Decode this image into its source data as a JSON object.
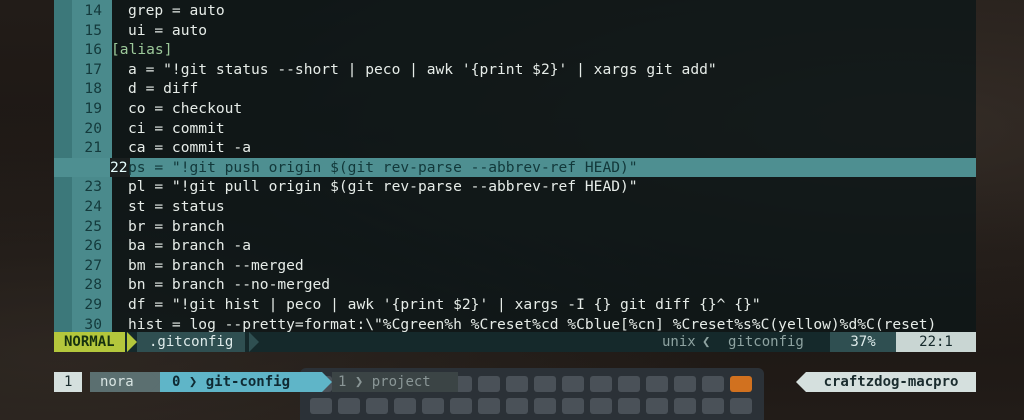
{
  "editor": {
    "lines": [
      {
        "num": "14",
        "text": "  grep = auto"
      },
      {
        "num": "15",
        "text": "  ui = auto"
      },
      {
        "num": "16",
        "text": "[alias]"
      },
      {
        "num": "17",
        "text": "  a = \"!git status --short | peco | awk '{print $2}' | xargs git add\""
      },
      {
        "num": "18",
        "text": "  d = diff"
      },
      {
        "num": "19",
        "text": "  co = checkout"
      },
      {
        "num": "20",
        "text": "  ci = commit"
      },
      {
        "num": "21",
        "text": "  ca = commit -a"
      },
      {
        "num": "22",
        "text": "  ps = \"!git push origin $(git rev-parse --abbrev-ref HEAD)\""
      },
      {
        "num": "23",
        "text": "  pl = \"!git pull origin $(git rev-parse --abbrev-ref HEAD)\""
      },
      {
        "num": "24",
        "text": "  st = status"
      },
      {
        "num": "25",
        "text": "  br = branch"
      },
      {
        "num": "26",
        "text": "  ba = branch -a"
      },
      {
        "num": "27",
        "text": "  bm = branch --merged"
      },
      {
        "num": "28",
        "text": "  bn = branch --no-merged"
      },
      {
        "num": "29",
        "text": "  df = \"!git hist | peco | awk '{print $2}' | xargs -I {} git diff {}^ {}\""
      },
      {
        "num": "30",
        "text": "  hist = log --pretty=format:\\\"%Cgreen%h %Creset%cd %Cblue[%cn] %Creset%s%C(yellow)%d%C(reset)"
      }
    ],
    "current_line": "22"
  },
  "statusline": {
    "mode": "NORMAL",
    "filename": ".gitconfig",
    "fileformat": "unix",
    "filetype": "gitconfig",
    "percent": "37%",
    "position": "22:1"
  },
  "tmux": {
    "window_index": "1",
    "session": "nora",
    "active_window_index": "0",
    "active_window_name": "git-config",
    "inactive_window_index": "1",
    "inactive_window_name": "project",
    "hostname": "craftzdog-macpro"
  },
  "colors": {
    "mode_bg": "#b4c73c",
    "cursorline_bg": "#4e8f91",
    "active_tab_bg": "#5fb5c8",
    "string": "#d7c57a"
  }
}
